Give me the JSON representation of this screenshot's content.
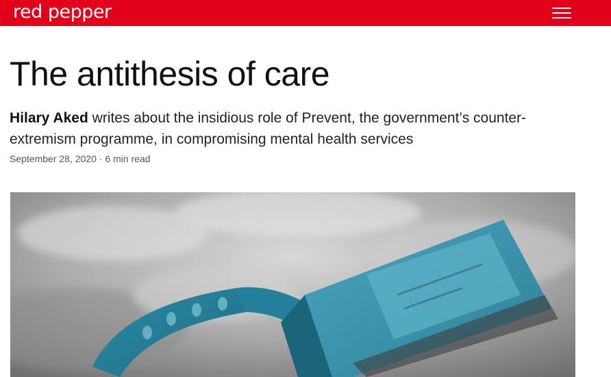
{
  "header": {
    "logo_text": "red pepper",
    "brand_color": "#e2001a",
    "menu_icon": "hamburger-menu-icon"
  },
  "article": {
    "title": "The antithesis of care",
    "author": "Hilary Aked",
    "standfirst": " writes about the insidious role of Prevent, the government’s counter-extremism programme, in compromising mental health services",
    "date": "September 28, 2020",
    "separator": " · ",
    "read_time": "6 min read"
  },
  "hero_image": {
    "description_icon": "hospital-wristband-photo"
  }
}
